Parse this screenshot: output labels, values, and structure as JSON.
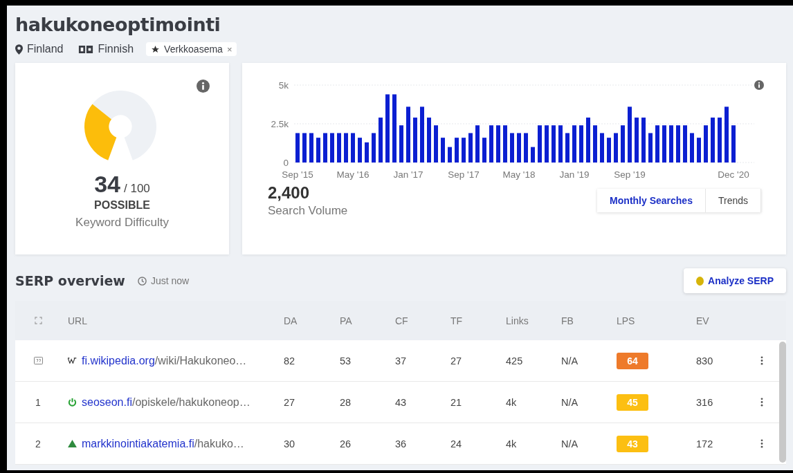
{
  "keyword": "hakukoneoptimointi",
  "meta": {
    "location": "Finland",
    "language": "Finnish",
    "tag": "Verkkoasema",
    "tag_close": "×"
  },
  "difficulty": {
    "score": "34",
    "out_of": "/ 100",
    "rating": "POSSIBLE",
    "label": "Keyword Difficulty"
  },
  "volume": {
    "value": "2,400",
    "label": "Search Volume",
    "toggle": [
      {
        "label": "Monthly Searches",
        "selected": true
      },
      {
        "label": "Trends",
        "selected": false
      }
    ],
    "chart_data": {
      "type": "bar",
      "ylim": [
        0,
        5000
      ],
      "yticks": [
        {
          "value": 0,
          "label": "0"
        },
        {
          "value": 2500,
          "label": "2.5k"
        },
        {
          "value": 5000,
          "label": "5k"
        }
      ],
      "categories": [
        "Sep '15",
        null,
        null,
        null,
        null,
        null,
        null,
        null,
        "May '16",
        null,
        null,
        null,
        null,
        null,
        null,
        null,
        "Jan '17",
        null,
        null,
        null,
        null,
        null,
        null,
        null,
        "Sep '17",
        null,
        null,
        null,
        null,
        null,
        null,
        null,
        "May '18",
        null,
        null,
        null,
        null,
        null,
        null,
        null,
        "Jan '19",
        null,
        null,
        null,
        null,
        null,
        null,
        null,
        "Sep '19",
        null,
        null,
        null,
        null,
        null,
        null,
        null,
        null,
        null,
        null,
        null,
        null,
        null,
        null,
        "Dec '20"
      ],
      "series": [
        {
          "color": "#0b1fd1",
          "values": [
            1900,
            1900,
            1900,
            1600,
            1900,
            1900,
            1900,
            1900,
            1900,
            1600,
            1300,
            1900,
            2900,
            4400,
            4400,
            2400,
            3600,
            2900,
            3600,
            2900,
            2400,
            1600,
            1000,
            1600,
            1600,
            1900,
            2400,
            1600,
            2400,
            2400,
            2400,
            1900,
            1900,
            1900,
            1000,
            2400,
            2400,
            2400,
            2400,
            1900,
            2400,
            2400,
            2900,
            2400,
            1900,
            1600,
            1900,
            2400,
            3600,
            2900,
            2900,
            1900,
            2400,
            2400,
            2400,
            2400,
            2400,
            1900,
            1600,
            2400,
            2900,
            2900,
            3600,
            2400
          ]
        }
      ]
    }
  },
  "serp": {
    "title": "SERP overview",
    "updated": "Just now",
    "analyze": "Analyze SERP",
    "columns": [
      "URL",
      "DA",
      "PA",
      "CF",
      "TF",
      "Links",
      "FB",
      "LPS",
      "EV"
    ],
    "rows": [
      {
        "kind": "snippet",
        "domain": "fi.wikipedia.org",
        "path": "/wiki/Hakukoneo…",
        "da": "82",
        "pa": "53",
        "cf": "37",
        "tf": "27",
        "links": "425",
        "fb": "N/A",
        "lps": "64",
        "color": "#ee7a2a",
        "ev": "830"
      },
      {
        "kind": "organic",
        "rank": "1",
        "domain": "seoseon.fi",
        "path": "/opiskele/hakukoneop…",
        "da": "27",
        "pa": "28",
        "cf": "43",
        "tf": "21",
        "links": "4k",
        "fb": "N/A",
        "lps": "45",
        "color": "#fcbf12",
        "ev": "316"
      },
      {
        "kind": "organic",
        "rank": "2",
        "domain": "markkinointiakatemia.fi",
        "path": "/hakuko…",
        "da": "30",
        "pa": "26",
        "cf": "36",
        "tf": "24",
        "links": "4k",
        "fb": "N/A",
        "lps": "43",
        "color": "#fcbf12",
        "ev": "172"
      }
    ]
  }
}
